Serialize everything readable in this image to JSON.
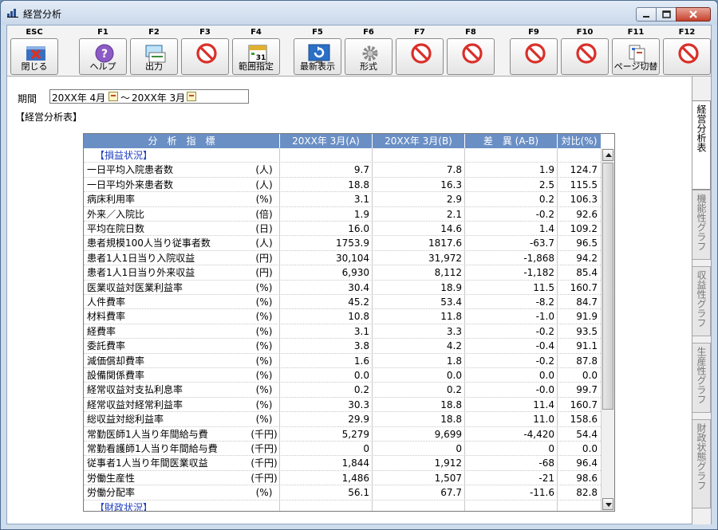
{
  "window": {
    "title": "経営分析"
  },
  "toolbar": {
    "keys": [
      {
        "key": "ESC",
        "label": "閉じる",
        "icon": "close-x-icon"
      },
      {
        "key": "F1",
        "label": "ヘルプ",
        "icon": "help-icon"
      },
      {
        "key": "F2",
        "label": "出力",
        "icon": "output-icon"
      },
      {
        "key": "F3",
        "label": "",
        "icon": "disabled-icon"
      },
      {
        "key": "F4",
        "label": "範囲指定",
        "icon": "calendar-icon"
      },
      {
        "key": "F5",
        "label": "最新表示",
        "icon": "refresh-icon"
      },
      {
        "key": "F6",
        "label": "形式",
        "icon": "gear-icon"
      },
      {
        "key": "F7",
        "label": "",
        "icon": "disabled-icon"
      },
      {
        "key": "F8",
        "label": "",
        "icon": "disabled-icon"
      },
      {
        "key": "F9",
        "label": "",
        "icon": "disabled-icon"
      },
      {
        "key": "F10",
        "label": "",
        "icon": "disabled-icon"
      },
      {
        "key": "F11",
        "label": "ページ切替",
        "icon": "page-switch-icon"
      },
      {
        "key": "F12",
        "label": "",
        "icon": "disabled-icon"
      }
    ]
  },
  "period": {
    "label": "期間",
    "from": "20XX年 4月",
    "separator": "～",
    "to": "20XX年 3月"
  },
  "section_title": "【経営分析表】",
  "grid": {
    "headers": [
      "分　析　指　標",
      "20XX年 3月(A)",
      "20XX年 3月(B)",
      "差　異 (A-B)",
      "対比(%)"
    ],
    "rows": [
      {
        "name": "【損益状況】",
        "unit": "",
        "a": "",
        "b": "",
        "d": "",
        "r": "",
        "section": true
      },
      {
        "name": "一日平均入院患者数",
        "unit": "(人)",
        "a": "9.7",
        "b": "7.8",
        "d": "1.9",
        "r": "124.7"
      },
      {
        "name": "一日平均外来患者数",
        "unit": "(人)",
        "a": "18.8",
        "b": "16.3",
        "d": "2.5",
        "r": "115.5"
      },
      {
        "name": "病床利用率",
        "unit": "(%)",
        "a": "3.1",
        "b": "2.9",
        "d": "0.2",
        "r": "106.3"
      },
      {
        "name": "外来／入院比",
        "unit": "(倍)",
        "a": "1.9",
        "b": "2.1",
        "d": "-0.2",
        "r": "92.6"
      },
      {
        "name": "平均在院日数",
        "unit": "(日)",
        "a": "16.0",
        "b": "14.6",
        "d": "1.4",
        "r": "109.2"
      },
      {
        "name": "患者規模100人当り従事者数",
        "unit": "(人)",
        "a": "1753.9",
        "b": "1817.6",
        "d": "-63.7",
        "r": "96.5"
      },
      {
        "name": "患者1人1日当り入院収益",
        "unit": "(円)",
        "a": "30,104",
        "b": "31,972",
        "d": "-1,868",
        "r": "94.2"
      },
      {
        "name": "患者1人1日当り外来収益",
        "unit": "(円)",
        "a": "6,930",
        "b": "8,112",
        "d": "-1,182",
        "r": "85.4"
      },
      {
        "name": "医業収益対医業利益率",
        "unit": "(%)",
        "a": "30.4",
        "b": "18.9",
        "d": "11.5",
        "r": "160.7"
      },
      {
        "name": "人件費率",
        "unit": "(%)",
        "a": "45.2",
        "b": "53.4",
        "d": "-8.2",
        "r": "84.7"
      },
      {
        "name": "材料費率",
        "unit": "(%)",
        "a": "10.8",
        "b": "11.8",
        "d": "-1.0",
        "r": "91.9"
      },
      {
        "name": "経費率",
        "unit": "(%)",
        "a": "3.1",
        "b": "3.3",
        "d": "-0.2",
        "r": "93.5"
      },
      {
        "name": "委託費率",
        "unit": "(%)",
        "a": "3.8",
        "b": "4.2",
        "d": "-0.4",
        "r": "91.1"
      },
      {
        "name": "減価償却費率",
        "unit": "(%)",
        "a": "1.6",
        "b": "1.8",
        "d": "-0.2",
        "r": "87.8"
      },
      {
        "name": "設備関係費率",
        "unit": "(%)",
        "a": "0.0",
        "b": "0.0",
        "d": "0.0",
        "r": "0.0"
      },
      {
        "name": "経常収益対支払利息率",
        "unit": "(%)",
        "a": "0.2",
        "b": "0.2",
        "d": "-0.0",
        "r": "99.7"
      },
      {
        "name": "経常収益対経常利益率",
        "unit": "(%)",
        "a": "30.3",
        "b": "18.8",
        "d": "11.4",
        "r": "160.7"
      },
      {
        "name": "総収益対総利益率",
        "unit": "(%)",
        "a": "29.9",
        "b": "18.8",
        "d": "11.0",
        "r": "158.6"
      },
      {
        "name": "常勤医師1人当り年間給与費",
        "unit": "(千円)",
        "a": "5,279",
        "b": "9,699",
        "d": "-4,420",
        "r": "54.4"
      },
      {
        "name": "常勤看護師1人当り年間給与費",
        "unit": "(千円)",
        "a": "0",
        "b": "0",
        "d": "0",
        "r": "0.0"
      },
      {
        "name": "従事者1人当り年間医業収益",
        "unit": "(千円)",
        "a": "1,844",
        "b": "1,912",
        "d": "-68",
        "r": "96.4"
      },
      {
        "name": "労働生産性",
        "unit": "(千円)",
        "a": "1,486",
        "b": "1,507",
        "d": "-21",
        "r": "98.6"
      },
      {
        "name": "労働分配率",
        "unit": "(%)",
        "a": "56.1",
        "b": "67.7",
        "d": "-11.6",
        "r": "82.8"
      },
      {
        "name": "【財政状況】",
        "unit": "",
        "a": "",
        "b": "",
        "d": "",
        "r": "",
        "section": true
      }
    ]
  },
  "side_tabs": [
    {
      "label": "経営分析表",
      "active": true
    },
    {
      "label": "機能性グラフ",
      "active": false
    },
    {
      "label": "収益性グラフ",
      "active": false
    },
    {
      "label": "生産性グラフ",
      "active": false
    },
    {
      "label": "財政状態グラフ",
      "active": false
    }
  ],
  "colors": {
    "header_bg": "#6a8fc5",
    "section_text": "#1f3fbf",
    "disabled_red": "#d9302a"
  }
}
